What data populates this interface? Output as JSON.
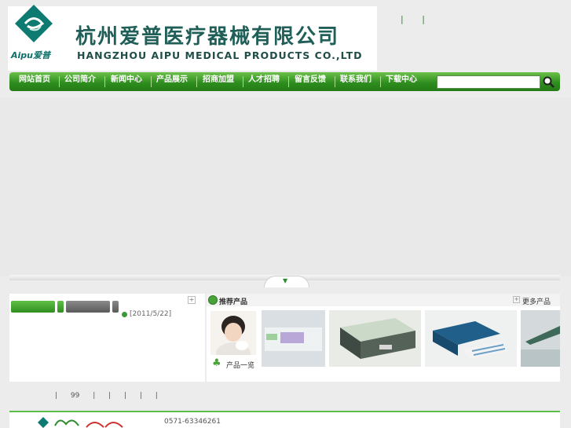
{
  "header": {
    "logo_text": "Aipu",
    "logo_text_cn": "爱普",
    "company_cn": "杭州爱普医疗器械有限公司",
    "company_en": "HANGZHOU AIPU MEDICAL PRODUCTS CO.,LTD",
    "top_links": "| |"
  },
  "nav": {
    "items": [
      "网站首页",
      "公司简介",
      "新闻中心",
      "产品展示",
      "招商加盟",
      "人才招聘",
      "留言反馈",
      "联系我们",
      "下载中心"
    ]
  },
  "search": {
    "value": "",
    "icon": "magnifier-icon"
  },
  "news": {
    "date": "[2011/5/22]",
    "plus": "+"
  },
  "products": {
    "title": "推荐产品",
    "more": "更多产品",
    "plus": "+",
    "list_label": "产品一览"
  },
  "footer": {
    "links": "| 99 | | | | |",
    "phone": "0571-63346261"
  },
  "colors": {
    "nav_green": "#2f8e1f",
    "brand_teal": "#1f5f58",
    "accent_green": "#4aa33a"
  }
}
